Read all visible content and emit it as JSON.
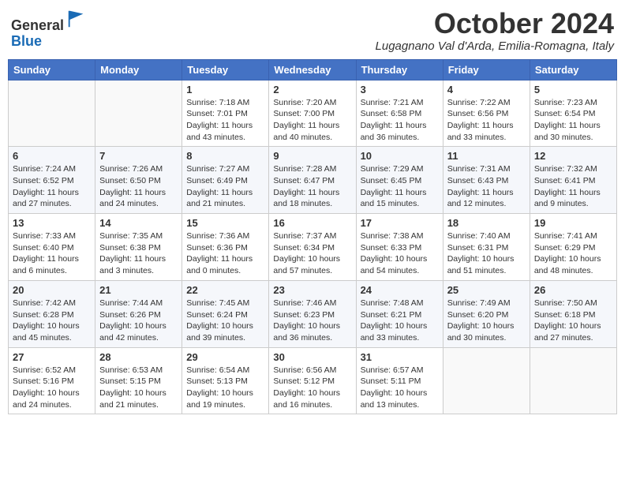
{
  "header": {
    "logo_line1": "General",
    "logo_line2": "Blue",
    "month_title": "October 2024",
    "location": "Lugagnano Val d'Arda, Emilia-Romagna, Italy"
  },
  "weekdays": [
    "Sunday",
    "Monday",
    "Tuesday",
    "Wednesday",
    "Thursday",
    "Friday",
    "Saturday"
  ],
  "weeks": [
    [
      {
        "day": "",
        "sunrise": "",
        "sunset": "",
        "daylight": ""
      },
      {
        "day": "",
        "sunrise": "",
        "sunset": "",
        "daylight": ""
      },
      {
        "day": "1",
        "sunrise": "Sunrise: 7:18 AM",
        "sunset": "Sunset: 7:01 PM",
        "daylight": "Daylight: 11 hours and 43 minutes."
      },
      {
        "day": "2",
        "sunrise": "Sunrise: 7:20 AM",
        "sunset": "Sunset: 7:00 PM",
        "daylight": "Daylight: 11 hours and 40 minutes."
      },
      {
        "day": "3",
        "sunrise": "Sunrise: 7:21 AM",
        "sunset": "Sunset: 6:58 PM",
        "daylight": "Daylight: 11 hours and 36 minutes."
      },
      {
        "day": "4",
        "sunrise": "Sunrise: 7:22 AM",
        "sunset": "Sunset: 6:56 PM",
        "daylight": "Daylight: 11 hours and 33 minutes."
      },
      {
        "day": "5",
        "sunrise": "Sunrise: 7:23 AM",
        "sunset": "Sunset: 6:54 PM",
        "daylight": "Daylight: 11 hours and 30 minutes."
      }
    ],
    [
      {
        "day": "6",
        "sunrise": "Sunrise: 7:24 AM",
        "sunset": "Sunset: 6:52 PM",
        "daylight": "Daylight: 11 hours and 27 minutes."
      },
      {
        "day": "7",
        "sunrise": "Sunrise: 7:26 AM",
        "sunset": "Sunset: 6:50 PM",
        "daylight": "Daylight: 11 hours and 24 minutes."
      },
      {
        "day": "8",
        "sunrise": "Sunrise: 7:27 AM",
        "sunset": "Sunset: 6:49 PM",
        "daylight": "Daylight: 11 hours and 21 minutes."
      },
      {
        "day": "9",
        "sunrise": "Sunrise: 7:28 AM",
        "sunset": "Sunset: 6:47 PM",
        "daylight": "Daylight: 11 hours and 18 minutes."
      },
      {
        "day": "10",
        "sunrise": "Sunrise: 7:29 AM",
        "sunset": "Sunset: 6:45 PM",
        "daylight": "Daylight: 11 hours and 15 minutes."
      },
      {
        "day": "11",
        "sunrise": "Sunrise: 7:31 AM",
        "sunset": "Sunset: 6:43 PM",
        "daylight": "Daylight: 11 hours and 12 minutes."
      },
      {
        "day": "12",
        "sunrise": "Sunrise: 7:32 AM",
        "sunset": "Sunset: 6:41 PM",
        "daylight": "Daylight: 11 hours and 9 minutes."
      }
    ],
    [
      {
        "day": "13",
        "sunrise": "Sunrise: 7:33 AM",
        "sunset": "Sunset: 6:40 PM",
        "daylight": "Daylight: 11 hours and 6 minutes."
      },
      {
        "day": "14",
        "sunrise": "Sunrise: 7:35 AM",
        "sunset": "Sunset: 6:38 PM",
        "daylight": "Daylight: 11 hours and 3 minutes."
      },
      {
        "day": "15",
        "sunrise": "Sunrise: 7:36 AM",
        "sunset": "Sunset: 6:36 PM",
        "daylight": "Daylight: 11 hours and 0 minutes."
      },
      {
        "day": "16",
        "sunrise": "Sunrise: 7:37 AM",
        "sunset": "Sunset: 6:34 PM",
        "daylight": "Daylight: 10 hours and 57 minutes."
      },
      {
        "day": "17",
        "sunrise": "Sunrise: 7:38 AM",
        "sunset": "Sunset: 6:33 PM",
        "daylight": "Daylight: 10 hours and 54 minutes."
      },
      {
        "day": "18",
        "sunrise": "Sunrise: 7:40 AM",
        "sunset": "Sunset: 6:31 PM",
        "daylight": "Daylight: 10 hours and 51 minutes."
      },
      {
        "day": "19",
        "sunrise": "Sunrise: 7:41 AM",
        "sunset": "Sunset: 6:29 PM",
        "daylight": "Daylight: 10 hours and 48 minutes."
      }
    ],
    [
      {
        "day": "20",
        "sunrise": "Sunrise: 7:42 AM",
        "sunset": "Sunset: 6:28 PM",
        "daylight": "Daylight: 10 hours and 45 minutes."
      },
      {
        "day": "21",
        "sunrise": "Sunrise: 7:44 AM",
        "sunset": "Sunset: 6:26 PM",
        "daylight": "Daylight: 10 hours and 42 minutes."
      },
      {
        "day": "22",
        "sunrise": "Sunrise: 7:45 AM",
        "sunset": "Sunset: 6:24 PM",
        "daylight": "Daylight: 10 hours and 39 minutes."
      },
      {
        "day": "23",
        "sunrise": "Sunrise: 7:46 AM",
        "sunset": "Sunset: 6:23 PM",
        "daylight": "Daylight: 10 hours and 36 minutes."
      },
      {
        "day": "24",
        "sunrise": "Sunrise: 7:48 AM",
        "sunset": "Sunset: 6:21 PM",
        "daylight": "Daylight: 10 hours and 33 minutes."
      },
      {
        "day": "25",
        "sunrise": "Sunrise: 7:49 AM",
        "sunset": "Sunset: 6:20 PM",
        "daylight": "Daylight: 10 hours and 30 minutes."
      },
      {
        "day": "26",
        "sunrise": "Sunrise: 7:50 AM",
        "sunset": "Sunset: 6:18 PM",
        "daylight": "Daylight: 10 hours and 27 minutes."
      }
    ],
    [
      {
        "day": "27",
        "sunrise": "Sunrise: 6:52 AM",
        "sunset": "Sunset: 5:16 PM",
        "daylight": "Daylight: 10 hours and 24 minutes."
      },
      {
        "day": "28",
        "sunrise": "Sunrise: 6:53 AM",
        "sunset": "Sunset: 5:15 PM",
        "daylight": "Daylight: 10 hours and 21 minutes."
      },
      {
        "day": "29",
        "sunrise": "Sunrise: 6:54 AM",
        "sunset": "Sunset: 5:13 PM",
        "daylight": "Daylight: 10 hours and 19 minutes."
      },
      {
        "day": "30",
        "sunrise": "Sunrise: 6:56 AM",
        "sunset": "Sunset: 5:12 PM",
        "daylight": "Daylight: 10 hours and 16 minutes."
      },
      {
        "day": "31",
        "sunrise": "Sunrise: 6:57 AM",
        "sunset": "Sunset: 5:11 PM",
        "daylight": "Daylight: 10 hours and 13 minutes."
      },
      {
        "day": "",
        "sunrise": "",
        "sunset": "",
        "daylight": ""
      },
      {
        "day": "",
        "sunrise": "",
        "sunset": "",
        "daylight": ""
      }
    ]
  ]
}
